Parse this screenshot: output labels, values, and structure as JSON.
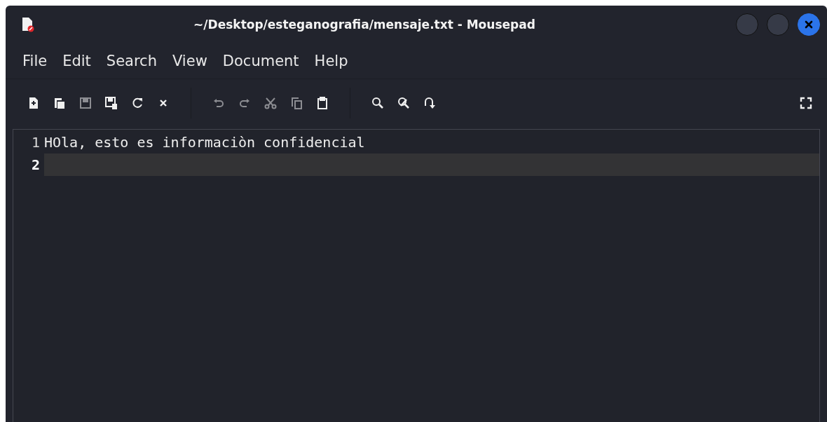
{
  "window": {
    "title": "~/Desktop/esteganografia/mensaje.txt - Mousepad"
  },
  "menu": [
    "File",
    "Edit",
    "Search",
    "View",
    "Document",
    "Help"
  ],
  "toolbar": [
    [
      {
        "kind": "new",
        "disabled": false
      },
      {
        "kind": "newwindow",
        "disabled": false
      },
      {
        "kind": "save",
        "disabled": true
      },
      {
        "kind": "saveas",
        "disabled": false
      },
      {
        "kind": "reload",
        "disabled": false
      },
      {
        "kind": "close",
        "disabled": false
      }
    ],
    [
      {
        "kind": "undo",
        "disabled": true
      },
      {
        "kind": "redo",
        "disabled": true
      },
      {
        "kind": "cut",
        "disabled": true
      },
      {
        "kind": "copy",
        "disabled": true
      },
      {
        "kind": "paste",
        "disabled": false
      }
    ],
    [
      {
        "kind": "find",
        "disabled": false
      },
      {
        "kind": "replace",
        "disabled": false
      },
      {
        "kind": "goto",
        "disabled": false
      }
    ]
  ],
  "lines": [
    {
      "number": "1",
      "text": "HOla, esto es informaciòn confidencial",
      "current": false
    },
    {
      "number": "2",
      "current": true
    }
  ]
}
